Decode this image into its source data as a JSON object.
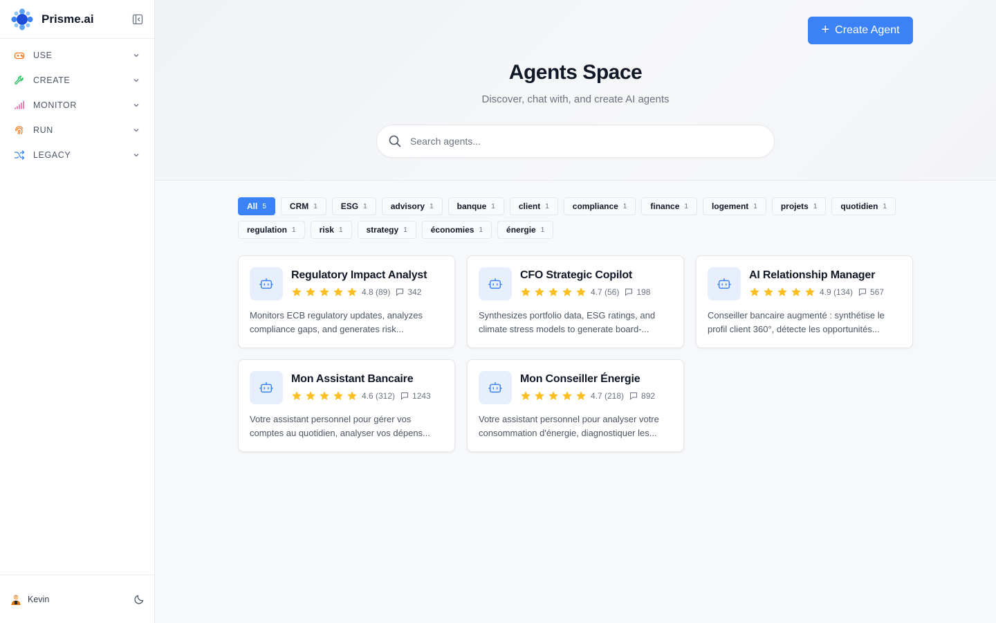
{
  "sidebar": {
    "brand": "Prisme.ai",
    "items": [
      {
        "label": "USE",
        "icon": "gamepad-icon",
        "color": "#f97316"
      },
      {
        "label": "CREATE",
        "icon": "wrench-icon",
        "color": "#22c55e"
      },
      {
        "label": "MONITOR",
        "icon": "signal-bars-icon",
        "color": "#ec4899"
      },
      {
        "label": "RUN",
        "icon": "fingerprint-icon",
        "color": "#f97316"
      },
      {
        "label": "LEGACY",
        "icon": "shuffle-icon",
        "color": "#3b82f6"
      }
    ],
    "user": {
      "name": "Kevin"
    }
  },
  "header": {
    "create_label": "Create Agent",
    "title": "Agents Space",
    "subtitle": "Discover, chat with, and create AI agents"
  },
  "search": {
    "placeholder": "Search agents...",
    "value": ""
  },
  "tags": [
    {
      "label": "All",
      "count": "5",
      "active": true
    },
    {
      "label": "CRM",
      "count": "1"
    },
    {
      "label": "ESG",
      "count": "1"
    },
    {
      "label": "advisory",
      "count": "1"
    },
    {
      "label": "banque",
      "count": "1"
    },
    {
      "label": "client",
      "count": "1"
    },
    {
      "label": "compliance",
      "count": "1"
    },
    {
      "label": "finance",
      "count": "1"
    },
    {
      "label": "logement",
      "count": "1"
    },
    {
      "label": "projets",
      "count": "1"
    },
    {
      "label": "quotidien",
      "count": "1"
    },
    {
      "label": "regulation",
      "count": "1"
    },
    {
      "label": "risk",
      "count": "1"
    },
    {
      "label": "strategy",
      "count": "1"
    },
    {
      "label": "économies",
      "count": "1"
    },
    {
      "label": "énergie",
      "count": "1"
    }
  ],
  "agents": [
    {
      "name": "Regulatory Impact Analyst",
      "stars": 5,
      "rating": "4.8 (89)",
      "comments": "342",
      "description": "Monitors ECB regulatory updates, analyzes compliance gaps, and generates risk..."
    },
    {
      "name": "CFO Strategic Copilot",
      "stars": 5,
      "rating": "4.7 (56)",
      "comments": "198",
      "description": "Synthesizes portfolio data, ESG ratings, and climate stress models to generate board-..."
    },
    {
      "name": "AI Relationship Manager",
      "stars": 5,
      "rating": "4.9 (134)",
      "comments": "567",
      "description": "Conseiller bancaire augmenté : synthétise le profil client 360°, détecte les opportunités..."
    },
    {
      "name": "Mon Assistant Bancaire",
      "stars": 5,
      "rating": "4.6 (312)",
      "comments": "1243",
      "description": "Votre assistant personnel pour gérer vos comptes au quotidien, analyser vos dépens..."
    },
    {
      "name": "Mon Conseiller Énergie",
      "stars": 5,
      "rating": "4.7 (218)",
      "comments": "892",
      "description": "Votre assistant personnel pour analyser votre consommation d'énergie, diagnostiquer les..."
    }
  ],
  "colors": {
    "accent": "#3b82f6",
    "star": "#fbbf24",
    "icon_bg": "#e8effc"
  }
}
